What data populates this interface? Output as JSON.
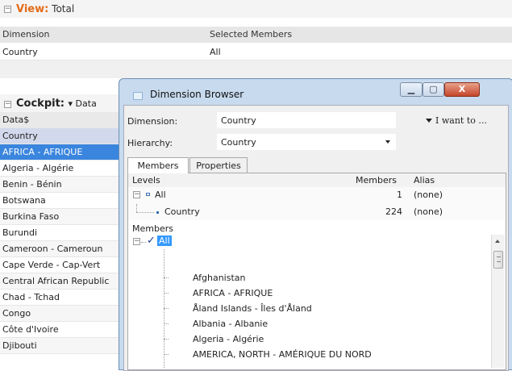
{
  "view": {
    "title_prefix": "View:",
    "title_value": "Total",
    "columns": [
      "Dimension",
      "Selected Members"
    ],
    "row": {
      "dimension": "Country",
      "selected": "All"
    }
  },
  "cockpit": {
    "title": "Cockpit:",
    "subtitle": "▾ Data",
    "items": [
      "Data$",
      "Country",
      "AFRICA - AFRIQUE",
      "Algeria - Algérie",
      "Benin - Bénin",
      "Botswana",
      "Burkina Faso",
      "Burundi",
      "Cameroon - Cameroun",
      "Cape Verde - Cap-Vert",
      "Central African Republic",
      "Chad - Tchad",
      "Congo",
      "Côte d'Ivoire",
      "Djibouti"
    ]
  },
  "dialog": {
    "title": "Dimension Browser",
    "buttons": {
      "min": "▁",
      "max": "▢",
      "close": "X"
    },
    "dimension_label": "Dimension:",
    "dimension_value": "Country",
    "i_want": "I want to ...",
    "hierarchy_label": "Hierarchy:",
    "hierarchy_value": "Country",
    "tabs": [
      "Members",
      "Properties"
    ],
    "levels": {
      "col_levels": "Levels",
      "col_members": "Members",
      "col_alias": "Alias",
      "rows": [
        {
          "name": "All",
          "members": "1",
          "alias": "(none)"
        },
        {
          "name": "Country",
          "members": "224",
          "alias": "(none)"
        }
      ]
    },
    "members_title": "Members",
    "root": "All",
    "member_list": [
      "Afghanistan",
      "AFRICA - AFRIQUE",
      "Åland Islands - Îles d'Åland",
      "Albania - Albanie",
      "Algeria - Algérie",
      "AMERICA, NORTH - AMÉRIQUE DU NORD"
    ]
  },
  "colors": {
    "accent_orange": "#e46b17",
    "selection_blue": "#3a85de",
    "dialog_frame": "#c7daee"
  }
}
